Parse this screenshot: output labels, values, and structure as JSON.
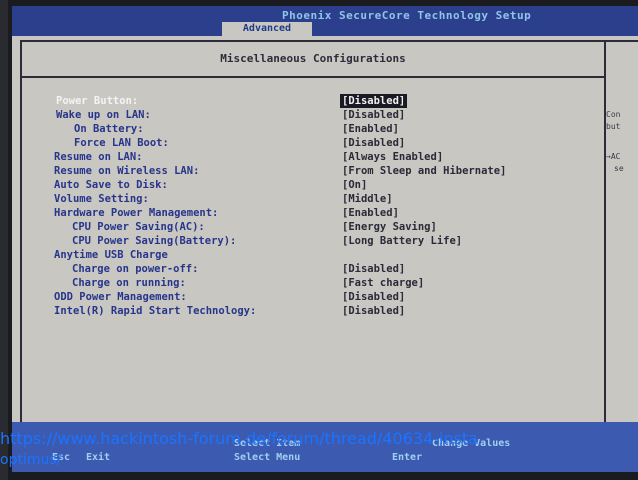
{
  "header": {
    "title": "Phoenix SecureCore Technology Setup",
    "active_tab": "Advanced"
  },
  "panel": {
    "title": "Miscellaneous Configurations"
  },
  "settings": [
    {
      "label": "Power Button:",
      "value": "[Disabled]"
    },
    {
      "label": "Wake up on LAN:",
      "value": "[Disabled]"
    },
    {
      "label": "On Battery:",
      "value": "[Enabled]"
    },
    {
      "label": "Force LAN Boot:",
      "value": "[Disabled]"
    },
    {
      "label": "Resume on LAN:",
      "value": "[Always Enabled]"
    },
    {
      "label": "Resume on Wireless LAN:",
      "value": "[From Sleep and Hibernate]"
    },
    {
      "label": "Auto Save to Disk:",
      "value": "[On]"
    },
    {
      "label": "Volume Setting:",
      "value": "[Middle]"
    },
    {
      "label": "Hardware Power Management:",
      "value": "[Enabled]"
    },
    {
      "label": "CPU Power Saving(AC):",
      "value": "[Energy Saving]"
    },
    {
      "label": "CPU Power Saving(Battery):",
      "value": "[Long Battery Life]"
    },
    {
      "label": "Anytime USB Charge",
      "value": ""
    },
    {
      "label": "Charge on power-off:",
      "value": "[Disabled]"
    },
    {
      "label": "Charge on running:",
      "value": "[Fast charge]"
    },
    {
      "label": "ODD Power Management:",
      "value": "[Disabled]"
    },
    {
      "label": "Intel(R) Rapid Start Technology:",
      "value": "[Disabled]"
    }
  ],
  "help": {
    "line1": "Con",
    "line2": "but",
    "line3": "→AC",
    "line4": "se"
  },
  "footer": {
    "esc_key": "Esc",
    "esc_action": "Exit",
    "select_item": "Select Item",
    "select_menu": "Select Menu",
    "change_values": "Change Values",
    "enter": "Enter"
  },
  "watermark": {
    "line1": "https://www.hackintosh-forum.de/forum/thread/40634-insta",
    "line2": "optimus/"
  },
  "colors": {
    "title_bar": "#2c3f8c",
    "screen_bg": "#c9c7c2",
    "label_blue": "#27358a",
    "watermark_link": "#1a74ff"
  }
}
